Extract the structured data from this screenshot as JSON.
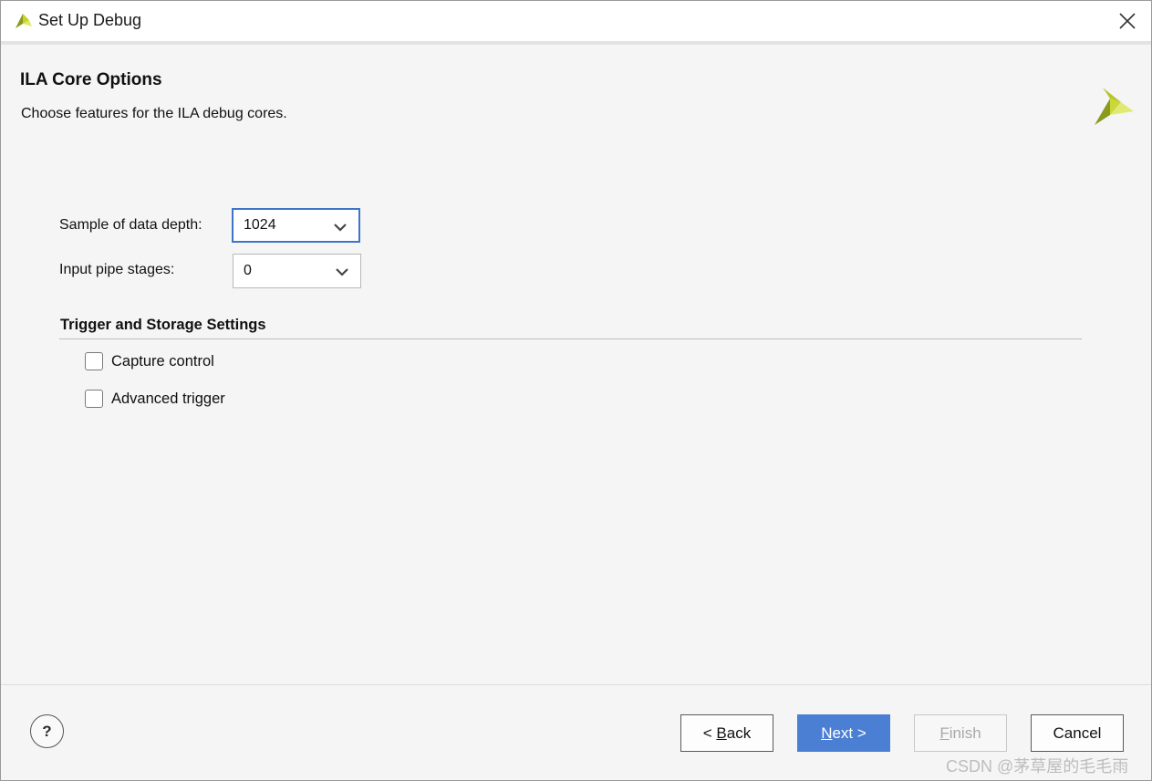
{
  "window": {
    "title": "Set Up Debug",
    "close_icon": "close-icon",
    "logo_icon": "xilinx-logo-icon"
  },
  "page": {
    "title": "ILA Core Options",
    "subtitle": "Choose features for the ILA debug cores."
  },
  "fields": {
    "data_depth": {
      "label": "Sample of data depth:",
      "value": "1024"
    },
    "pipe_stages": {
      "label": "Input pipe stages:",
      "value": "0"
    }
  },
  "trigger_section": {
    "header": "Trigger and Storage Settings",
    "options": [
      {
        "label": "Capture control",
        "checked": false
      },
      {
        "label": "Advanced trigger",
        "checked": false
      }
    ]
  },
  "footer": {
    "help_label": "?",
    "back": {
      "prefix": "< ",
      "mnemonic": "B",
      "rest": "ack"
    },
    "next": {
      "mnemonic": "N",
      "rest": "ext >"
    },
    "finish": {
      "mnemonic": "F",
      "rest": "inish",
      "enabled": false
    },
    "cancel": "Cancel"
  },
  "watermark": "CSDN @茅草屋的毛毛雨",
  "colors": {
    "accent": "#4a7fd4",
    "focus_border": "#3e74c7",
    "logo_dark": "#8a9a1a",
    "logo_light": "#d6e23a"
  }
}
